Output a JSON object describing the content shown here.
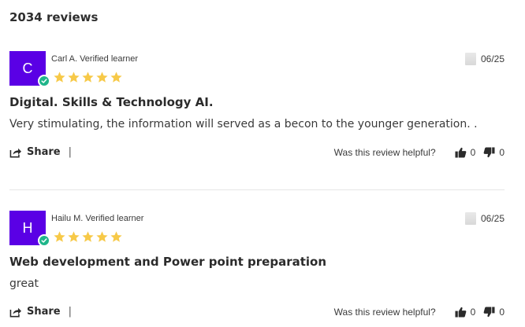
{
  "reviews_count": "2034 reviews",
  "colors": {
    "avatar_bg": "#5a00e5",
    "star": "#f7c948",
    "verified": "#1fb58a"
  },
  "reviews": [
    {
      "initial": "C",
      "reviewer": "Carl A. Verified learner",
      "rating": 5,
      "date": "06/25",
      "title": "Digital. Skills & Technology AI.",
      "body": "Very stimulating, the information will served as a becon to the younger generation. .",
      "share_label": "Share",
      "separator": "|",
      "helpful_question": "Was this review helpful?",
      "upvotes": "0",
      "downvotes": "0"
    },
    {
      "initial": "H",
      "reviewer": "Hailu M. Verified learner",
      "rating": 5,
      "date": "06/25",
      "title": "Web development and Power point preparation",
      "body": "great",
      "share_label": "Share",
      "separator": "|",
      "helpful_question": "Was this review helpful?",
      "upvotes": "0",
      "downvotes": "0"
    }
  ]
}
